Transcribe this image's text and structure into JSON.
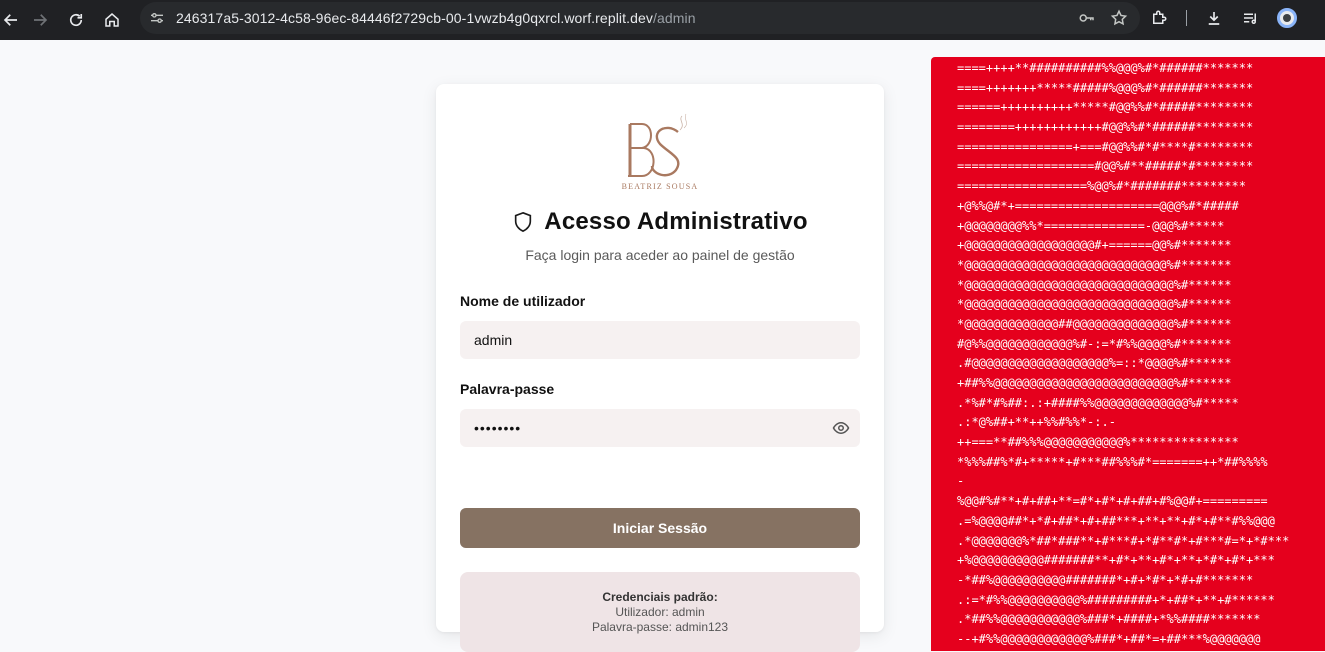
{
  "browser": {
    "url_host": "246317a5-3012-4c58-96ec-84446f2729cb-00-1vwzb4g0qxrcl.worf.replit.dev",
    "url_path": "/admin",
    "icons": [
      "back-icon",
      "forward-icon",
      "reload-icon",
      "home-icon",
      "site-settings-icon",
      "password-key-icon",
      "bookmark-star-icon",
      "extensions-icon",
      "downloads-icon",
      "media-control-icon",
      "profile-icon"
    ]
  },
  "login": {
    "logo_text": "BEATRIZ SOUSA",
    "logo_letters": "BS",
    "title": "Acesso Administrativo",
    "subtitle": "Faça login para aceder ao painel de gestão",
    "username_label": "Nome de utilizador",
    "username_value": "admin",
    "password_label": "Palavra-passe",
    "password_value": "••••••••",
    "submit_label": "Iniciar Sessão",
    "credentials_title": "Credenciais padrão:",
    "credentials_user": "Utilizador: admin",
    "credentials_pass": "Palavra-passe: admin123"
  },
  "colors": {
    "brand_brown": "#867262",
    "logo_copper": "#a97960",
    "panel_red": "#e5001d"
  },
  "ascii_art": [
    "====++++**##########%%@@@%#*######*******",
    "====+++++++*****#####%@@@%#*######*******",
    "======++++++++++*****#@@%%#*#####********",
    "========++++++++++++#@@%%#*######********",
    "================+===#@@%%#*#****#********",
    "===================#@@%#**#####*#********",
    "==================%@@%#*#######*********",
    "+@%%@#*+====================@@@%#*#####",
    "+@@@@@@@@%%*==============-@@@%#*****",
    "+@@@@@@@@@@@@@@@@@@#+======@@%#*******",
    "*@@@@@@@@@@@@@@@@@@@@@@@@@@@@%#*******",
    "*@@@@@@@@@@@@@@@@@@@@@@@@@@@@@%#******",
    "*@@@@@@@@@@@@@@@@@@@@@@@@@@@@@%#******",
    "*@@@@@@@@@@@@@##@@@@@@@@@@@@@@%#******",
    "#@%%@@@@@@@@@@@@%#-:=*#%%@@@@%#*******",
    ".#@@@@@@@@@@@@@@@@@@@%=::*@@@@%#******",
    "+##%%@@@@@@@@@@@@@@@@@@@@@@@@@%#******",
    ".*%#*#%##:.:+####%%@@@@@@@@@@@@@%#*****",
    ".:*@%##+**++%%#%%*-:.-",
    "++===**##%%%@@@@@@@@@@@%***************",
    "*%%%##%*#+*****+#***##%%%#*=======++*##%%%%",
    "-",
    "%@@#%#**+#+##+**=#*+#*+#+##+#%@@#+=========",
    ".=%@@@@##*+*#+##*+#+##***+**+**+#*+#**#%%@@@",
    ".*@@@@@@@%*##*###**+#***#+*#**#*+#***#=*+*#***",
    "+%@@@@@@@@@@#######**+#*+**+#*+**+*#*+#*+***",
    "-*##%@@@@@@@@@@#######*+#+*#*+*#+#*******",
    ".:=*#%%@@@@@@@@@@%#########+*+##*+**+#******",
    ".*##%%@@@@@@@@@@@%###*+####+*%%####*******",
    "--+#%%@@@@@@@@@@@@%###*+##*=+##***%@@@@@@@"
  ]
}
